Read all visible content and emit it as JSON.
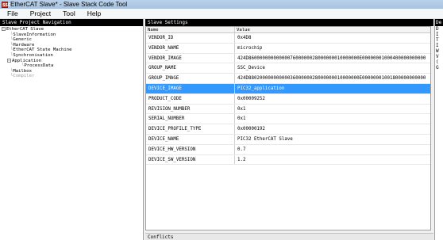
{
  "window": {
    "title": "EtherCAT Slave* - Slave Stack Code Tool",
    "icon_label": "SSC"
  },
  "menu": [
    {
      "label": "File"
    },
    {
      "label": "Project"
    },
    {
      "label": "Tool"
    },
    {
      "label": "Help"
    }
  ],
  "navigation": {
    "header": "Slave Project Navigation",
    "root": "EtherCAT Slave",
    "items": [
      "SlaveInformation",
      "Generic",
      "Hardware",
      "EtherCAT State Machine",
      "Synchronisation",
      "Application",
      "ProcessData",
      "Mailbox",
      "Compiler"
    ]
  },
  "settings": {
    "header": "Slave Settings",
    "col_name": "Name",
    "col_value": "Value",
    "rows": [
      {
        "name": "VENDOR_ID",
        "value": "0x4D8"
      },
      {
        "name": "VENDOR_NAME",
        "value": "microchip"
      },
      {
        "name": "VENDOR_IMAGE",
        "value": "424D8600000000000007600000028000000010000000E00000001000400000000000"
      },
      {
        "name": "GROUP_NAME",
        "value": "SSC_Device"
      },
      {
        "name": "GROUP_IMAGE",
        "value": "424D8802000000000003600000028000000010000000E00000001001800000000000"
      },
      {
        "name": "DEVICE_IMAGE",
        "value": "PIC32_application"
      },
      {
        "name": "PRODUCT_CODE",
        "value": "0x00009252"
      },
      {
        "name": "REVISION_NUMBER",
        "value": "0x1"
      },
      {
        "name": "SERIAL_NUMBER",
        "value": "0x1"
      },
      {
        "name": "DEVICE_PROFILE_TYPE",
        "value": "0x00000192"
      },
      {
        "name": "DEVICE_NAME",
        "value": "PIC32 EtherCAT Slave"
      },
      {
        "name": "DEVICE_HW_VERSION",
        "value": "0.7"
      },
      {
        "name": "DEVICE_SW_VERSION",
        "value": "1.2"
      }
    ],
    "selected_row": "DEVICE_IMAGE"
  },
  "conflicts": {
    "header": "Conflicts"
  },
  "side_strip": {
    "header": "De",
    "lines": [
      "D",
      "",
      "I",
      "",
      "T",
      "I",
      "W",
      "V",
      "",
      "",
      "(",
      "",
      "",
      "G"
    ]
  }
}
